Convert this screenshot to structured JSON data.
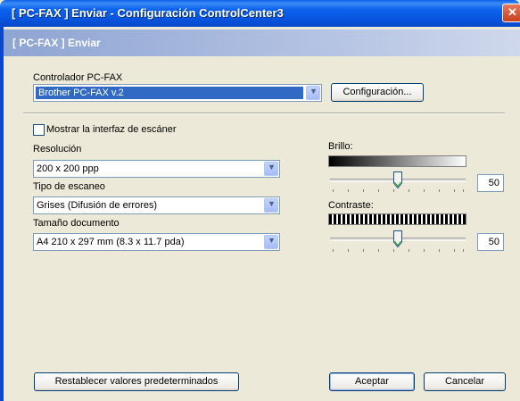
{
  "window": {
    "title": "[ PC-FAX ]  Enviar - Configuración ControlCenter3",
    "close_glyph": "✕"
  },
  "banner": {
    "text": "[ PC-FAX ]  Enviar"
  },
  "driver": {
    "label": "Controlador PC-FAX",
    "value": "Brother PC-FAX v.2",
    "config_button": "Configuración..."
  },
  "scanner_interface": {
    "label": "Mostrar la interfaz de escáner",
    "checked": false
  },
  "resolution": {
    "label": "Resolución",
    "value": "200 x 200 ppp"
  },
  "scan_type": {
    "label": "Tipo de escaneo",
    "value": "Grises (Difusión de errores)"
  },
  "doc_size": {
    "label": "Tamaño documento",
    "value": "A4 210 x 297 mm (8.3 x 11.7 pda)"
  },
  "brightness": {
    "label": "Brillo:",
    "value": "50"
  },
  "contrast": {
    "label": "Contraste:",
    "value": "50"
  },
  "footer": {
    "reset_button": "Restablecer valores predeterminados",
    "ok_button": "Aceptar",
    "cancel_button": "Cancelar"
  },
  "icons": {
    "dropdown": "chevron-down-icon",
    "close": "close-icon"
  }
}
